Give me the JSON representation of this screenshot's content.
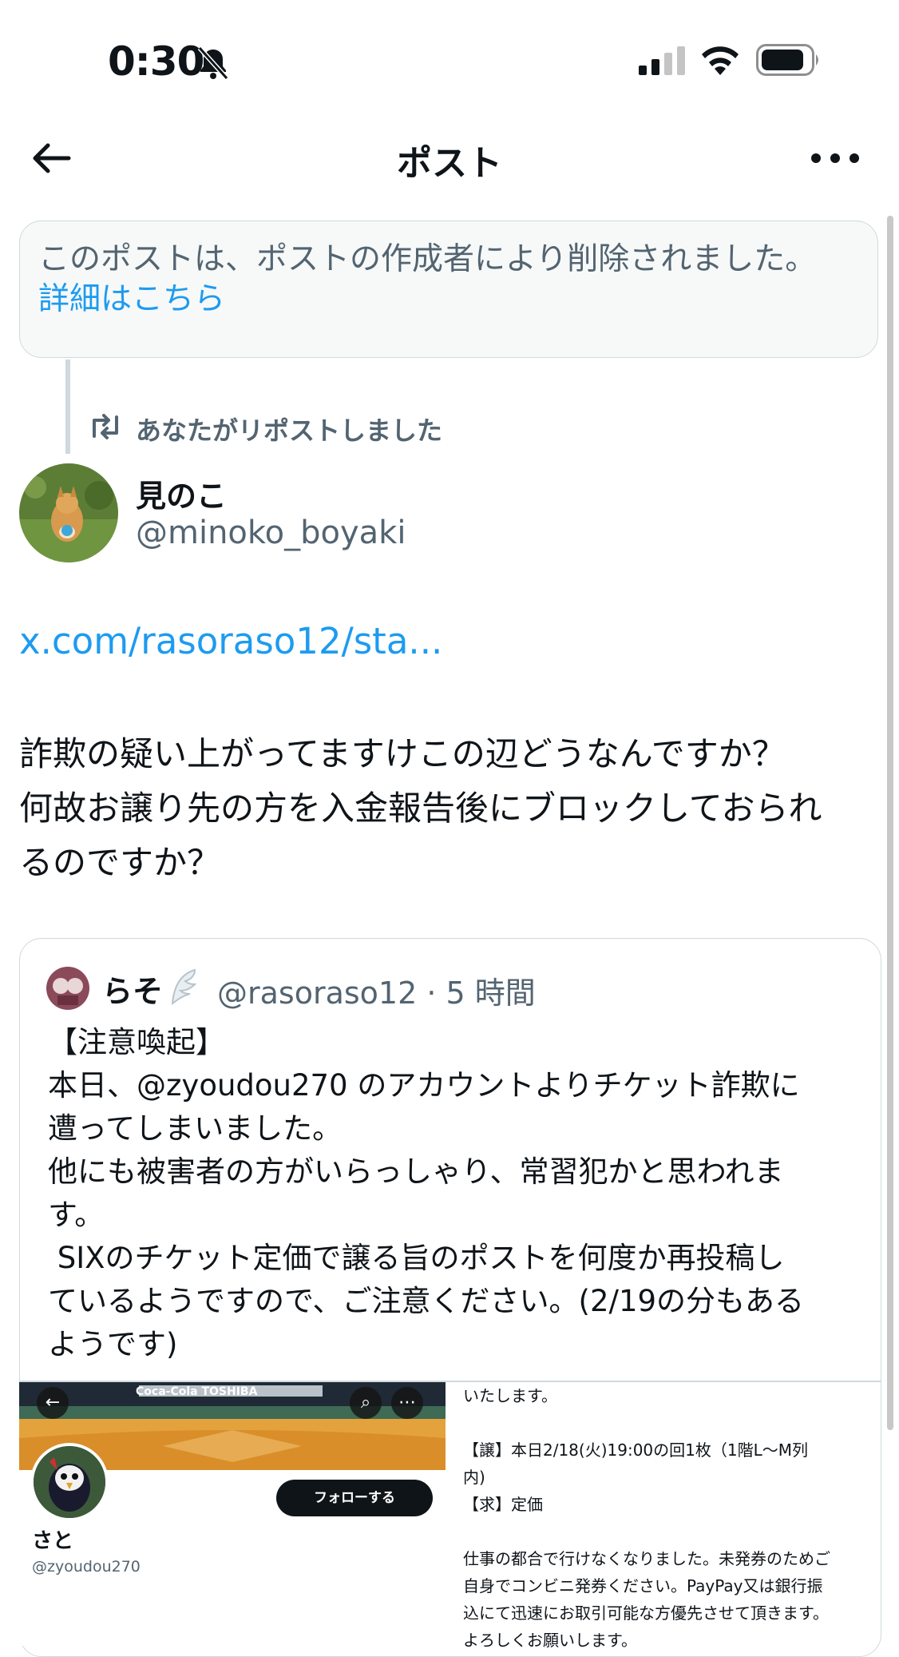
{
  "status_bar": {
    "time": "0:30"
  },
  "nav": {
    "title": "ポスト"
  },
  "deleted_notice": {
    "text": "このポストは、ポストの作成者により削除されました。",
    "link": "詳細はこちら"
  },
  "repost": {
    "label": "あなたがリポストしました"
  },
  "author": {
    "name": "見のこ",
    "handle": "@minoko_boyaki"
  },
  "post": {
    "link": "x.com/rasoraso12/sta...",
    "body": [
      "詐欺の疑い上がってますけこの辺どうなんですか？",
      "何故お譲り先の方を入金報告後にブロックしておられ",
      "るのですか？"
    ]
  },
  "quote": {
    "name": "らそ",
    "handle_time": "@rasoraso12 · 5 時間",
    "body": "【注意喚起】\n本日、@zyoudou270 のアカウントよりチケット詐欺に\n遭ってしまいました。\n他にも被害者の方がいらっしゃり、常習犯かと思われま\nす。\n SIXのチケット定価で譲る旨のポストを何度か再投稿し\nているようですので、ご注意ください。(2/19の分もある\nようです)"
  },
  "embed_left": {
    "stadium_banner": "Coca-Cola  TOSHIBA",
    "follow_label": "フォローする",
    "profile_name": "さと",
    "profile_handle": "@zyoudou270"
  },
  "embed_right": {
    "text": "いたします。\n\n【譲】本日2/18(火)19:00の回1枚（1階L～M列\n内)\n【求】定価\n\n仕事の都合で行けなくなりました。未発券のためご\n自身でコンビニ発券ください。PayPay又は銀行振\n込にて迅速にお取引可能な方優先させて頂きます。\nよろしくお願いします。"
  },
  "colors": {
    "accent": "#1d9bf0",
    "text_primary": "#0f1419",
    "text_secondary": "#536471",
    "border": "#cfd9de",
    "notice_bg": "#f7f9f9"
  },
  "icons": [
    "bell-off-icon",
    "signal-icon",
    "wifi-icon",
    "battery-icon",
    "back-arrow-icon",
    "more-icon",
    "repost-icon",
    "wing-badge-icon",
    "search-icon"
  ]
}
